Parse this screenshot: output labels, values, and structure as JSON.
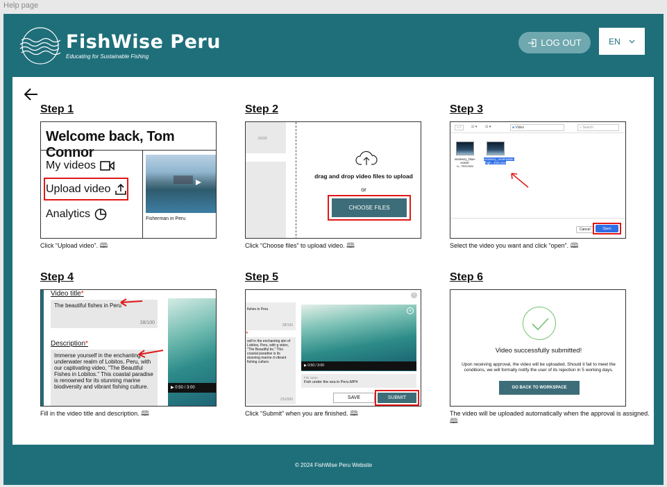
{
  "page_label": "Help page",
  "brand": {
    "name": "FishWise Peru",
    "tagline": "Educating for Sustainable Fishing"
  },
  "header": {
    "logout_label": "LOG OUT",
    "language": "EN"
  },
  "steps": [
    {
      "title": "Step 1",
      "caption": "Click “Upload video”.",
      "shot": {
        "welcome": "Welcome back, Tom Connor",
        "menu": [
          "My videos",
          "Upload video",
          "Analytics"
        ],
        "video_caption": "Fisherman in Peru"
      }
    },
    {
      "title": "Step 2",
      "caption": "Click “Choose files” to upload video.",
      "shot": {
        "counter": "0/100",
        "drag_text": "drag and drop video files to upload",
        "or_text": "or",
        "button": "CHOOSE FILES"
      }
    },
    {
      "title": "Step 3",
      "caption": "Select the video you want and click “open”.",
      "shot": {
        "folder": "Video",
        "search": "Search",
        "files": [
          "vecteezy_blue-ocean-u...744.mov",
          "vecteezy_underwater-high...815.mov"
        ],
        "cancel": "Cancel",
        "open": "Open"
      }
    },
    {
      "title": "Step 4",
      "caption": "Fill in the video title and description.",
      "shot": {
        "title_label": "Video title",
        "title_value": "The beautiful fishes in Peru",
        "title_count": "28/100",
        "desc_label": "Description",
        "desc_value": "Immerse yourself in the enchanting underwater realm of Lobitos, Peru, with our captivating video, \"The Beautiful Fishes in Lobitos.\" This coastal paradise is renowned for its stunning marine biodiversity and vibrant fishing culture.",
        "time": "0:50 / 3:00",
        "required": "*"
      }
    },
    {
      "title": "Step 5",
      "caption": "Click “Submit” when you are finished.",
      "shot": {
        "left_title": "fishes in Peru",
        "left_count": "28/100",
        "left_desc": "self in the enchanting alm of Lobitos, Peru, with g video, \"The Beautiful bs.\" This coastal paradise is its stunning marine d vibrant fishing culture.",
        "left_count2": "231/500",
        "time": "0:50 / 3:00",
        "file_label": "File name",
        "file_name": "Fish under the sea in Peru.MP4",
        "save": "SAVE",
        "submit": "SUBMIT",
        "help": "?"
      }
    },
    {
      "title": "Step 6",
      "caption": "The video will be uploaded automatically when the approval is assigned.",
      "shot": {
        "title": "Video successfully submitted!",
        "desc": "Upon receiving approval, the video will be uploaded. Should it fail to meet the conditions, we will formally notify the user of its rejection in 5 working days.",
        "button": "GO BACK TO WORKSPACE"
      }
    }
  ],
  "footer": "© 2024 FishWise Peru Website",
  "colors": {
    "brand_teal": "#1f6f7a",
    "button_teal": "#3d6d78",
    "highlight_red": "#e01616",
    "open_blue": "#2e6ee6"
  }
}
